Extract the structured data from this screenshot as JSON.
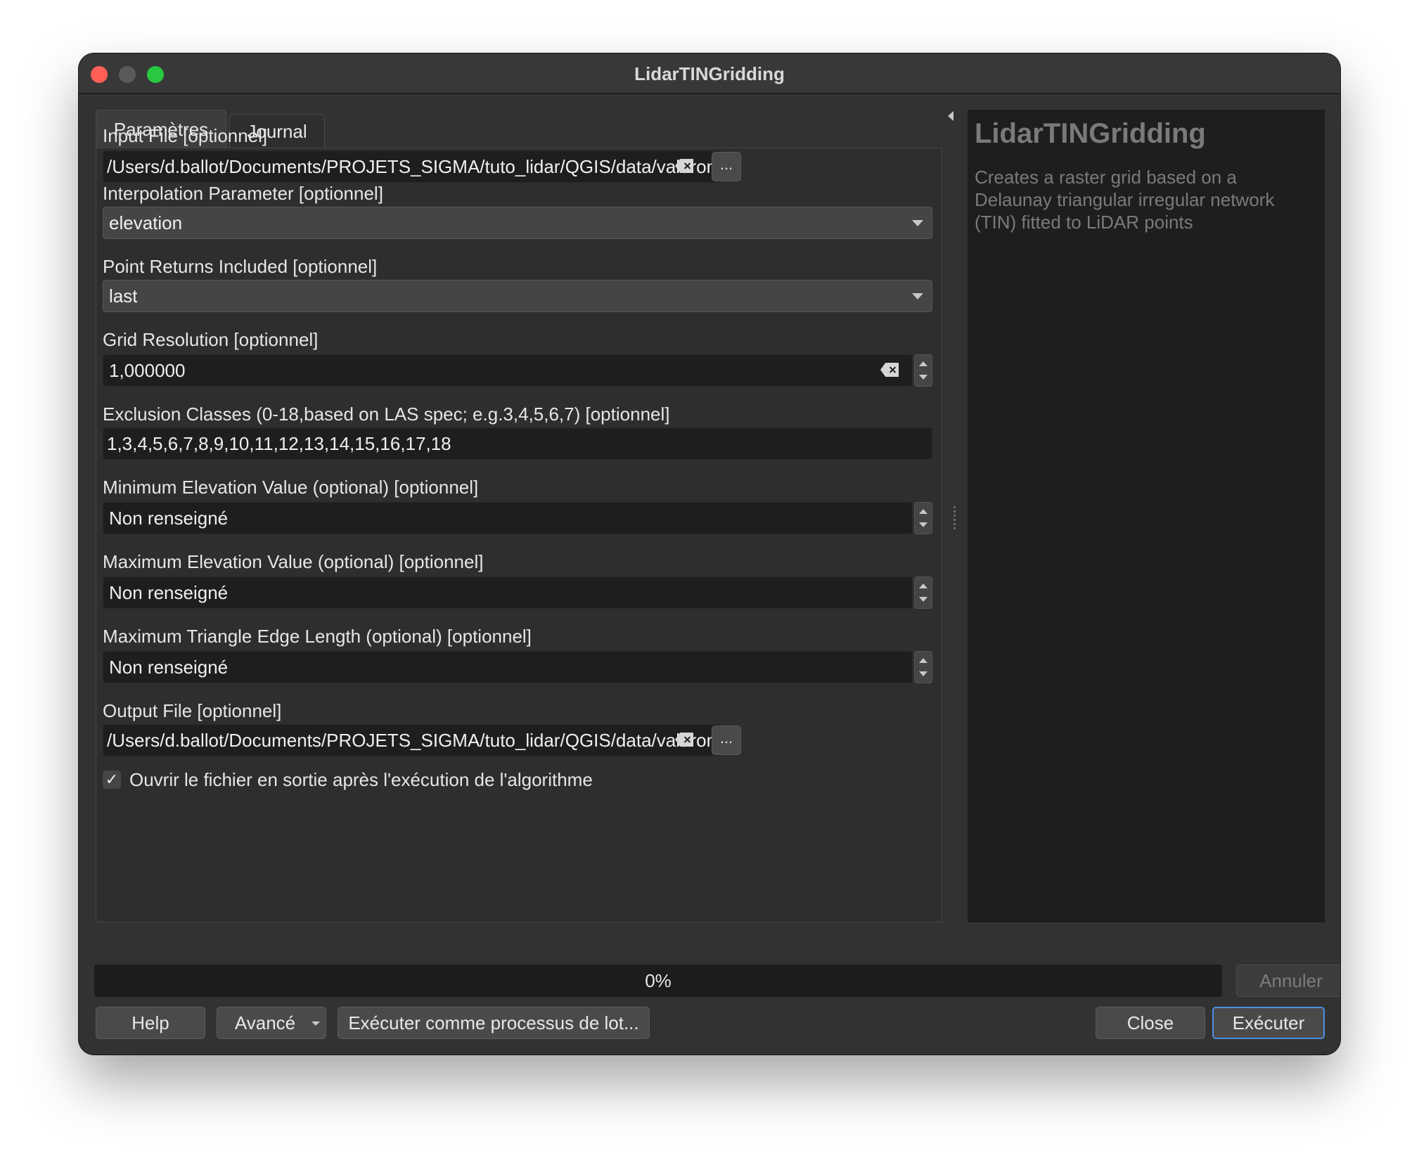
{
  "window": {
    "title": "LidarTINGridding"
  },
  "tabs": [
    {
      "label": "Paramètres"
    },
    {
      "label": "Journal"
    }
  ],
  "params": {
    "input_file": {
      "label": "Input File [optionnel]",
      "value": "/Users/d.ballot/Documents/PROJETS_SIGMA/tuto_lidar/QGIS/data/valdrome_lidar.laz",
      "browse": "..."
    },
    "interpolation": {
      "label": "Interpolation Parameter [optionnel]",
      "value": "elevation"
    },
    "returns": {
      "label": "Point Returns Included [optionnel]",
      "value": "last"
    },
    "resolution": {
      "label": "Grid Resolution [optionnel]",
      "value": "1,000000"
    },
    "exclusion": {
      "label": "Exclusion Classes (0-18,based on LAS spec; e.g.3,4,5,6,7) [optionnel]",
      "value": "1,3,4,5,6,7,8,9,10,11,12,13,14,15,16,17,18"
    },
    "min_elev": {
      "label": "Minimum Elevation Value (optional) [optionnel]",
      "value": "Non renseigné"
    },
    "max_elev": {
      "label": "Maximum Elevation Value (optional) [optionnel]",
      "value": "Non renseigné"
    },
    "max_edge": {
      "label": "Maximum Triangle Edge Length (optional) [optionnel]",
      "value": "Non renseigné"
    },
    "output_file": {
      "label": "Output File [optionnel]",
      "value": "/Users/d.ballot/Documents/PROJETS_SIGMA/tuto_lidar/QGIS/data/valdrome_mnt.tif",
      "browse": "..."
    },
    "open_output": {
      "label": "Ouvrir le fichier en sortie après l'exécution de l'algorithme",
      "checked": true,
      "check_glyph": "✓"
    }
  },
  "help": {
    "title": "LidarTINGridding",
    "description": "Creates a raster grid based on a Delaunay triangular irregular network (TIN) fitted to LiDAR points"
  },
  "progress": {
    "text": "0%",
    "value": 0
  },
  "buttons": {
    "cancel": "Annuler",
    "help": "Help",
    "advanced": "Avancé",
    "batch": "Exécuter comme processus de lot...",
    "close": "Close",
    "run": "Exécuter"
  },
  "colors": {
    "window_bg": "#323232",
    "field_bg": "#1e1e1e",
    "default_button_border": "#4a90e2",
    "close_light": "#ff5f57",
    "zoom_light": "#28c840"
  }
}
